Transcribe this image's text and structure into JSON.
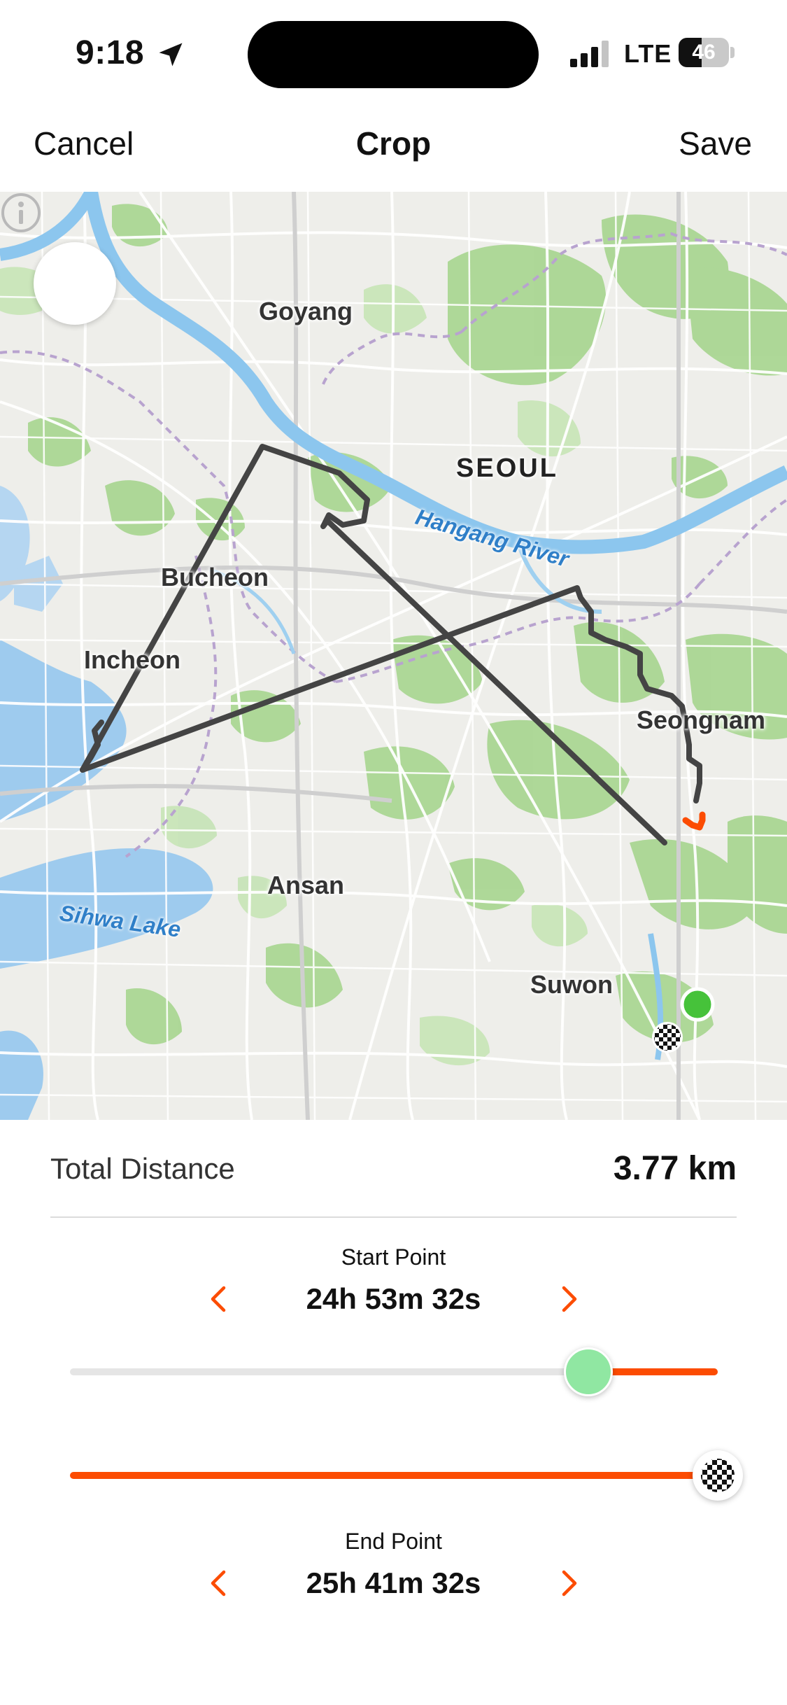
{
  "status_bar": {
    "time": "9:18",
    "network": "LTE",
    "battery_level": "46",
    "battery_fraction": 0.46
  },
  "nav": {
    "cancel_label": "Cancel",
    "title": "Crop",
    "save_label": "Save"
  },
  "map": {
    "labels": {
      "goyang": "Goyang",
      "seoul": "SEOUL",
      "hangang": "Hangang River",
      "bucheon": "Bucheon",
      "incheon": "Incheon",
      "seongnam": "Seongnam",
      "ansan": "Ansan",
      "sihwa": "Sihwa Lake",
      "suwon": "Suwon"
    },
    "route_color": "#444444",
    "cropped_route_color": "#fc4c02",
    "start_marker_color": "#46c23a",
    "end_marker": "checkered-flag-icon"
  },
  "summary": {
    "total_distance_label": "Total Distance",
    "total_distance_value": "3.77 km"
  },
  "start_point": {
    "label": "Start Point",
    "value": "24h 53m 32s",
    "slider_fraction": 0.8
  },
  "end_point": {
    "label": "End Point",
    "value": "25h 41m 32s",
    "slider_fraction": 1.0
  },
  "colors": {
    "accent": "#fc4c02",
    "start_knob": "#90e7a2",
    "track_inactive": "#e5e5e5"
  }
}
